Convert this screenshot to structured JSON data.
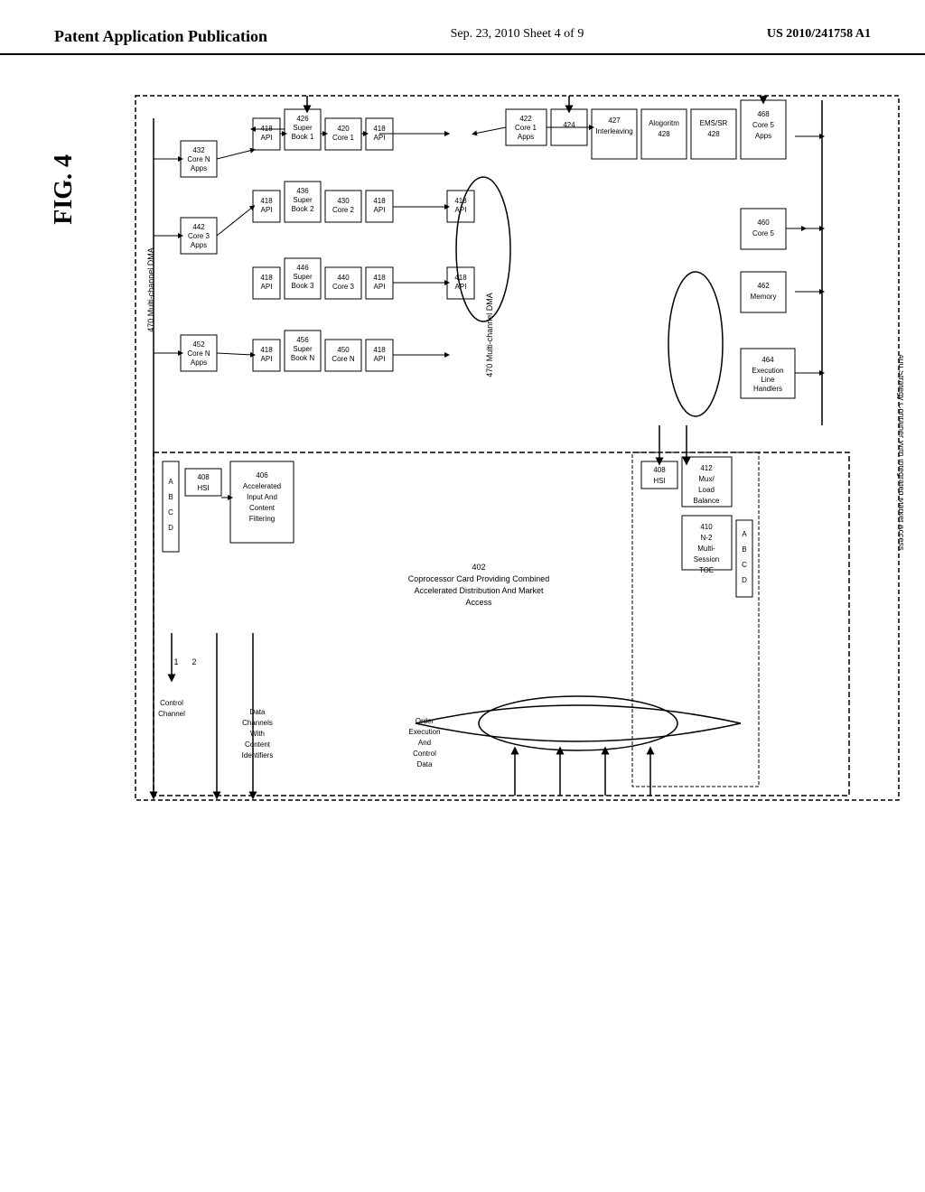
{
  "header": {
    "left_label": "Patent Application Publication",
    "center_label": "Sep. 23, 2010   Sheet 4 of 9",
    "right_label": "US 2010/241758 A1"
  },
  "figure": {
    "label": "FIG. 4",
    "title": "400 Strategy Container With Integrated Market Access"
  }
}
